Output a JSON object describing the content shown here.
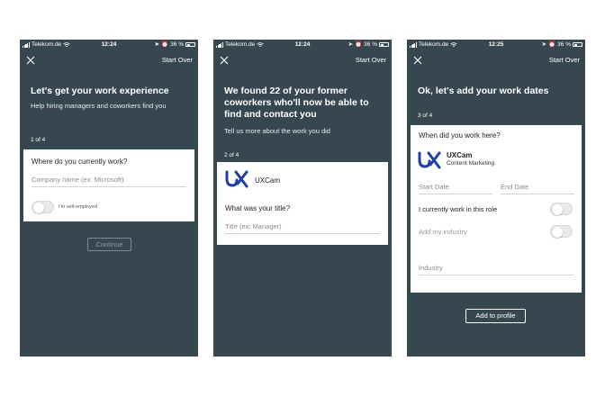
{
  "statusbar": {
    "carrier": "Telekom.de",
    "battery": "36 %",
    "times": [
      "12:24",
      "12:24",
      "12:25"
    ]
  },
  "common": {
    "start_over": "Start Over",
    "close_icon": "close-icon",
    "company_name": "UXCam",
    "company_logo": "UX"
  },
  "screen1": {
    "headline": "Let's get your work experience",
    "subtext": "Help hiring managers and coworkers find you",
    "step": "1 of 4",
    "question": "Where do you currently work?",
    "company_placeholder": "Company name (ex: Microsoft)",
    "self_employed_label": "I'm self-employed",
    "continue": "Continue"
  },
  "screen2": {
    "headline": "We found 22 of your former coworkers who'll now be able to find and contact you",
    "subtext": "Tell us more about the work you did",
    "step": "2 of 4",
    "question": "What was your title?",
    "title_placeholder": "Title (ex: Manager)"
  },
  "screen3": {
    "headline": "Ok, let's add your work dates",
    "step": "3 of 4",
    "question": "When did you work here?",
    "role": "Content Marketing",
    "start_date": "Start Date",
    "end_date": "End Date",
    "current_work": "I currently work in this role",
    "add_industry": "Add my industry",
    "industry": "Industry",
    "add_to_profile": "Add to profile"
  },
  "colors": {
    "background": "#36474f",
    "card": "#ffffff",
    "logo_blue": "#1f3fa8"
  }
}
